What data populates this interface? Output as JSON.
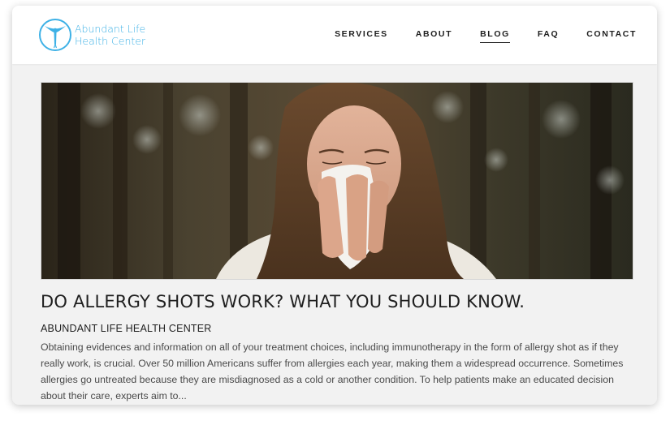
{
  "brand": {
    "name_line1": "Abundant Life",
    "name_line2": "Health Center",
    "color": "#3eb1e6"
  },
  "nav": {
    "items": [
      {
        "label": "SERVICES",
        "active": false
      },
      {
        "label": "ABOUT",
        "active": false
      },
      {
        "label": "BLOG",
        "active": true
      },
      {
        "label": "FAQ",
        "active": false
      },
      {
        "label": "CONTACT",
        "active": false
      }
    ]
  },
  "post": {
    "title": "DO ALLERGY SHOTS WORK? WHAT YOU SHOULD KNOW.",
    "author": "ABUNDANT LIFE HEALTH CENTER",
    "excerpt": "Obtaining evidences and information on all of your treatment choices, including immunotherapy in the form of allergy shot as if they really work, is crucial. Over 50 million Americans suffer from allergies each year, making them a widespread occurrence. Sometimes allergies go untreated because they are misdiagnosed as a cold or another condition. To help patients make an educated decision about their care, experts aim to...",
    "image_subject": "woman-sneezing-into-tissue"
  }
}
